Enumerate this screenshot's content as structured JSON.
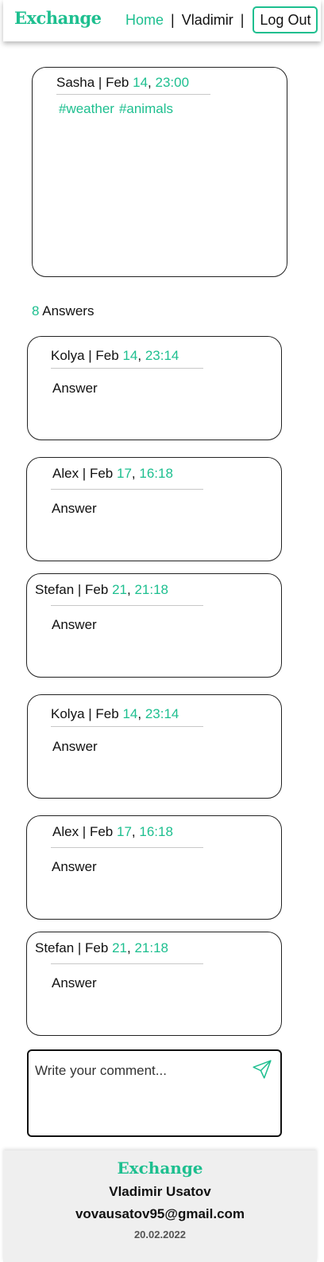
{
  "header": {
    "logo": "Exchange",
    "nav": {
      "home": "Home",
      "separator": "|",
      "user": "Vladimir",
      "logout": "Log Out"
    }
  },
  "question": {
    "author": "Sasha",
    "sep": " | ",
    "month": "Feb ",
    "day": "14",
    "comma": ", ",
    "time": "23:00",
    "tags": [
      "#weather",
      "#animals"
    ]
  },
  "answers_count": {
    "count": "8",
    "label": " Answers"
  },
  "answers": [
    {
      "author": "Kolya",
      "sep": " | ",
      "month": "Feb ",
      "day": "14",
      "comma": ", ",
      "time": "23:14",
      "text": "Answer"
    },
    {
      "author": "Alex",
      "sep": " | ",
      "month": "Feb ",
      "day": "17",
      "comma": ", ",
      "time": "16:18",
      "text": "Answer"
    },
    {
      "author": "Stefan",
      "sep": " | ",
      "month": "Feb ",
      "day": "21",
      "comma": ", ",
      "time": "21:18",
      "text": "Answer"
    },
    {
      "author": "Kolya",
      "sep": " | ",
      "month": "Feb ",
      "day": "14",
      "comma": ", ",
      "time": "23:14",
      "text": "Answer"
    },
    {
      "author": "Alex",
      "sep": " | ",
      "month": "Feb ",
      "day": "17",
      "comma": ", ",
      "time": "16:18",
      "text": "Answer"
    },
    {
      "author": "Stefan",
      "sep": " | ",
      "month": "Feb ",
      "day": "21",
      "comma": ", ",
      "time": "21:18",
      "text": "Answer"
    }
  ],
  "comment": {
    "placeholder": "Write your comment...",
    "send_icon": "send-icon"
  },
  "footer": {
    "logo": "Exchange",
    "name": "Vladimir Usatov",
    "email": "vovausatov95@gmail.com",
    "date": "20.02.2022"
  },
  "colors": {
    "accent": "#1dbf8f",
    "text": "#111111",
    "footer_bg": "#efefef"
  }
}
